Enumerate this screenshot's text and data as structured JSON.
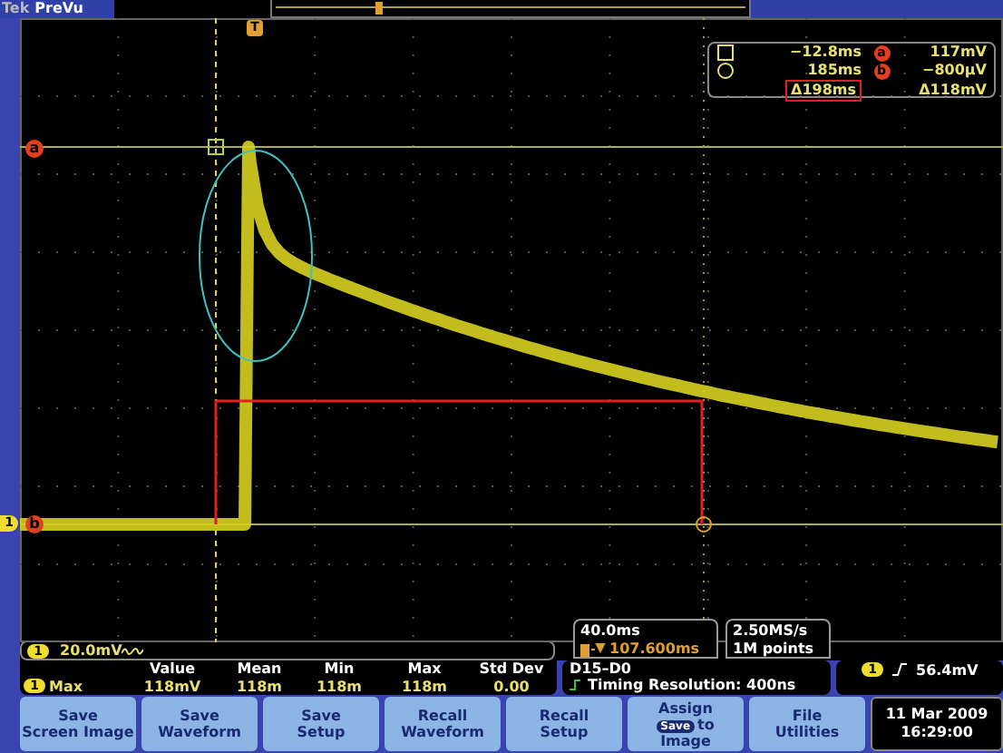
{
  "top_bar": {
    "brand": "Tek",
    "mode": "PreVu"
  },
  "markers": {
    "trigger": "T",
    "cursor_a": "a",
    "cursor_b": "b",
    "channel": "1"
  },
  "cursor_readout": {
    "rows": [
      {
        "kind": "square",
        "time": "−12.8ms",
        "marker": "a",
        "value": "117mV"
      },
      {
        "kind": "circle",
        "time": "185ms",
        "marker": "b",
        "value": "−800µV"
      }
    ],
    "delta_time": "Δ198ms",
    "delta_value": "Δ118mV",
    "delta_time_highlighted": true
  },
  "horizontal": {
    "scale": "40.0ms",
    "delay": "107.600ms"
  },
  "acquisition": {
    "rate": "2.50MS/s",
    "length": "1M points"
  },
  "channel_readout": {
    "channel": "1",
    "scale": "20.0mV"
  },
  "measurement": {
    "channel": "1",
    "name": "Max",
    "columns": [
      "Value",
      "Mean",
      "Min",
      "Max",
      "Std Dev"
    ],
    "values": [
      "118mV",
      "118m",
      "118m",
      "118m",
      "0.00"
    ]
  },
  "digital": {
    "label": "D15–D0",
    "resolution": "Timing Resolution: 400ns"
  },
  "trigger": {
    "channel": "1",
    "level": "56.4mV"
  },
  "buttons": [
    {
      "kind": "text",
      "lines": [
        "Save",
        "Screen Image"
      ]
    },
    {
      "kind": "text",
      "lines": [
        "Save",
        "Waveform"
      ]
    },
    {
      "kind": "text",
      "lines": [
        "Save",
        "Setup"
      ]
    },
    {
      "kind": "text",
      "lines": [
        "Recall",
        "Waveform"
      ]
    },
    {
      "kind": "text",
      "lines": [
        "Recall",
        "Setup"
      ]
    },
    {
      "kind": "badge",
      "lines": [
        "Assign",
        "Image"
      ],
      "badge": "Save",
      "after": "to"
    },
    {
      "kind": "text",
      "lines": [
        "File",
        "Utilities"
      ]
    }
  ],
  "clock": {
    "date": "11 Mar 2009",
    "time": "16:29:00"
  }
}
